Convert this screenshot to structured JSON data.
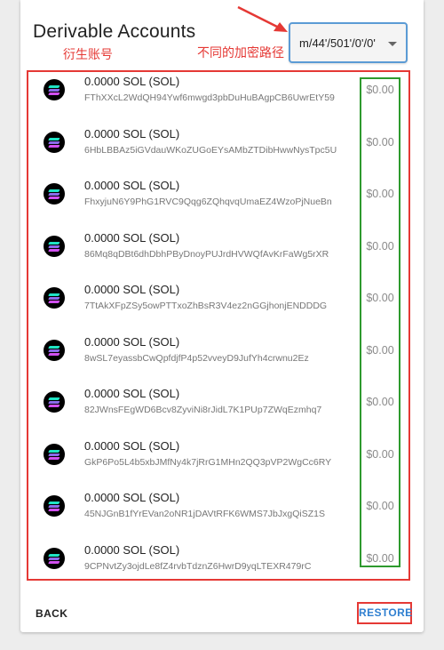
{
  "header": {
    "title": "Derivable Accounts",
    "annotation_accounts": "衍生账号",
    "annotation_paths": "不同的加密路径"
  },
  "path_select": {
    "value": "m/44'/501'/0'/0'"
  },
  "accounts": [
    {
      "balance": "0.0000 SOL (SOL)",
      "address": "FThXXcL2WdQH94Ywf6mwgd3pbDuHuBAgpCB6UwrEtY59",
      "usd": "$0.00"
    },
    {
      "balance": "0.0000 SOL (SOL)",
      "address": "6HbLBBAz5iGVdauWKoZUGoEYsAMbZTDibHwwNysTpc5U",
      "usd": "$0.00"
    },
    {
      "balance": "0.0000 SOL (SOL)",
      "address": "FhxyjuN6Y9PhG1RVC9Qqg6ZQhqvqUmaEZ4WzoPjNueBn",
      "usd": "$0.00"
    },
    {
      "balance": "0.0000 SOL (SOL)",
      "address": "86Mq8qDBt6dhDbhPByDnoyPUJrdHVWQfAvKrFaWg5rXR",
      "usd": "$0.00"
    },
    {
      "balance": "0.0000 SOL (SOL)",
      "address": "7TtAkXFpZSy5owPTTxoZhBsR3V4ez2nGGjhonjENDDDG",
      "usd": "$0.00"
    },
    {
      "balance": "0.0000 SOL (SOL)",
      "address": "8wSL7eyassbCwQpfdjfP4p52vveyD9JufYh4crwnu2Ez",
      "usd": "$0.00"
    },
    {
      "balance": "0.0000 SOL (SOL)",
      "address": "82JWnsFEgWD6Bcv8ZyviNi8rJidL7K1PUp7ZWqEzmhq7",
      "usd": "$0.00"
    },
    {
      "balance": "0.0000 SOL (SOL)",
      "address": "GkP6Po5L4b5xbJMfNy4k7jRrG1MHn2QQ3pVP2WgCc6RY",
      "usd": "$0.00"
    },
    {
      "balance": "0.0000 SOL (SOL)",
      "address": "45NJGnB1fYrEVan2oNR1jDAVtRFK6WMS7JbJxgQiSZ1S",
      "usd": "$0.00"
    },
    {
      "balance": "0.0000 SOL (SOL)",
      "address": "9CPNvtZy3ojdLe8fZ4rvbTdznZ6HwrD9yqLTEXR479rC",
      "usd": "$0.00"
    }
  ],
  "footer": {
    "back_label": "BACK",
    "restore_label": "RESTORE"
  },
  "colors": {
    "annotation_red": "#e53935",
    "annotation_green": "#2e9a2e",
    "select_border": "#5b9bd5",
    "restore_blue": "#2f7fd0"
  },
  "icons": {
    "account": "solana-logo-icon",
    "select": "caret-down-icon",
    "annotation": "red-arrow-icon"
  }
}
